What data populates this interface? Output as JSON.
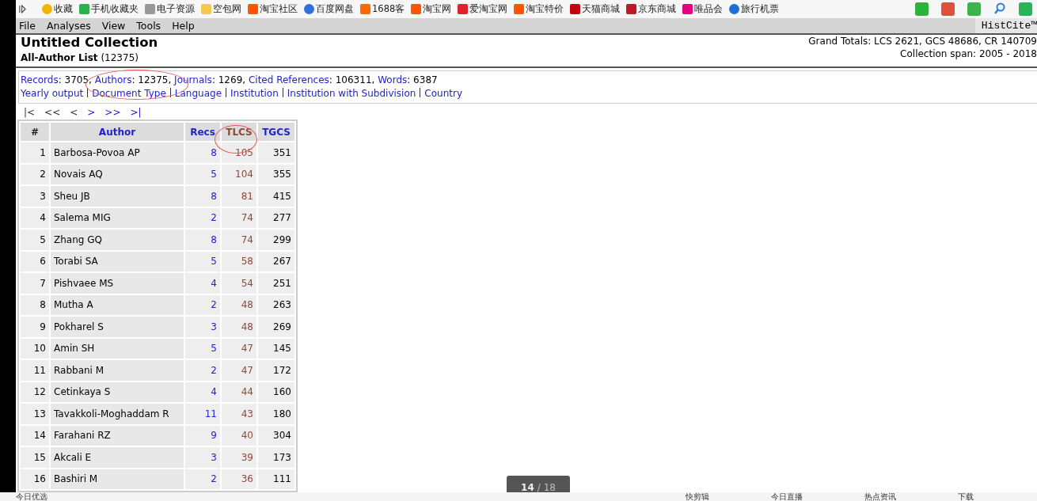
{
  "bookmarks": [
    {
      "label": "收藏",
      "kind": "star"
    },
    {
      "label": "手机收藏夹",
      "kind": "phone"
    },
    {
      "label": "电子资源",
      "kind": "doc"
    },
    {
      "label": "空包网",
      "kind": "folder"
    },
    {
      "label": "淘宝社区",
      "kind": "tao"
    },
    {
      "label": "百度网盘",
      "kind": "cloud"
    },
    {
      "label": "1688客",
      "kind": "ali"
    },
    {
      "label": "淘宝网",
      "kind": "tao"
    },
    {
      "label": "爱淘宝网",
      "kind": "taored"
    },
    {
      "label": "淘宝特价",
      "kind": "tao"
    },
    {
      "label": "天猫商城",
      "kind": "tmall"
    },
    {
      "label": "京东商城",
      "kind": "jd"
    },
    {
      "label": "唯品会",
      "kind": "vip"
    },
    {
      "label": "旅行机票",
      "kind": "plane"
    }
  ],
  "menu": [
    "File",
    "Analyses",
    "View",
    "Tools",
    "Help"
  ],
  "brand": "HistCite™",
  "title": "Untitled Collection",
  "subtitle": "All-Author List",
  "subtitle_count": "(12375)",
  "grand_totals": "Grand Totals: LCS 2621, GCS 48686, CR 140709",
  "span": "Collection span: 2005 - 2018",
  "stats": [
    {
      "label": "Records",
      "value": ": 3705,"
    },
    {
      "label": "Authors",
      "value": ": 12375,"
    },
    {
      "label": "Journals",
      "value": ": 1269,"
    },
    {
      "label": "Cited References",
      "value": ": 106311,"
    },
    {
      "label": "Words",
      "value": ": 6387"
    }
  ],
  "views": [
    "Yearly output",
    "Document Type",
    "Language",
    "Institution",
    "Institution with Subdivision",
    "Country"
  ],
  "pager": [
    {
      "label": "|<",
      "enabled": false
    },
    {
      "label": "<<",
      "enabled": false
    },
    {
      "label": "<",
      "enabled": false
    },
    {
      "label": ">",
      "enabled": true
    },
    {
      "label": ">>",
      "enabled": true
    },
    {
      "label": ">|",
      "enabled": true
    }
  ],
  "table": {
    "columns": [
      {
        "label": "#",
        "sorted": false
      },
      {
        "label": "Author",
        "sorted": false
      },
      {
        "label": "Recs",
        "sorted": false
      },
      {
        "label": "TLCS",
        "sorted": true
      },
      {
        "label": "TGCS",
        "sorted": false
      }
    ],
    "rows": [
      [
        "1",
        "Barbosa-Povoa AP",
        "8",
        "105",
        "351"
      ],
      [
        "2",
        "Novais AQ",
        "5",
        "104",
        "355"
      ],
      [
        "3",
        "Sheu JB",
        "8",
        "81",
        "415"
      ],
      [
        "4",
        "Salema MIG",
        "2",
        "74",
        "277"
      ],
      [
        "5",
        "Zhang GQ",
        "8",
        "74",
        "299"
      ],
      [
        "6",
        "Torabi SA",
        "5",
        "58",
        "267"
      ],
      [
        "7",
        "Pishvaee MS",
        "4",
        "54",
        "251"
      ],
      [
        "8",
        "Mutha A",
        "2",
        "48",
        "263"
      ],
      [
        "9",
        "Pokharel S",
        "3",
        "48",
        "269"
      ],
      [
        "10",
        "Amin SH",
        "5",
        "47",
        "145"
      ],
      [
        "11",
        "Rabbani M",
        "2",
        "47",
        "172"
      ],
      [
        "12",
        "Cetinkaya S",
        "4",
        "44",
        "160"
      ],
      [
        "13",
        "Tavakkoli-Moghaddam R",
        "11",
        "43",
        "180"
      ],
      [
        "14",
        "Farahani RZ",
        "9",
        "40",
        "304"
      ],
      [
        "15",
        "Akcali E",
        "3",
        "39",
        "173"
      ],
      [
        "16",
        "Bashiri M",
        "2",
        "36",
        "111"
      ]
    ]
  },
  "page_indicator": {
    "current": "14",
    "total": "/ 18"
  },
  "status_bar": [
    "今日优选",
    "快剪辑",
    "今日直播",
    "热点资讯",
    "下载"
  ]
}
